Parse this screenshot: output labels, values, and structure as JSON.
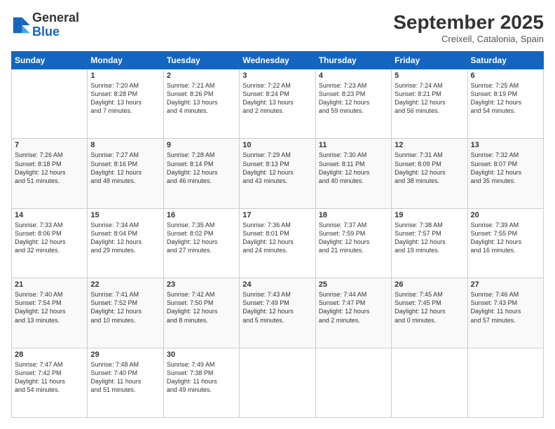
{
  "logo": {
    "line1": "General",
    "line2": "Blue"
  },
  "header": {
    "month": "September 2025",
    "location": "Creixell, Catalonia, Spain"
  },
  "weekdays": [
    "Sunday",
    "Monday",
    "Tuesday",
    "Wednesday",
    "Thursday",
    "Friday",
    "Saturday"
  ],
  "weeks": [
    [
      {
        "day": "",
        "info": ""
      },
      {
        "day": "1",
        "info": "Sunrise: 7:20 AM\nSunset: 8:28 PM\nDaylight: 13 hours\nand 7 minutes."
      },
      {
        "day": "2",
        "info": "Sunrise: 7:21 AM\nSunset: 8:26 PM\nDaylight: 13 hours\nand 4 minutes."
      },
      {
        "day": "3",
        "info": "Sunrise: 7:22 AM\nSunset: 8:24 PM\nDaylight: 13 hours\nand 2 minutes."
      },
      {
        "day": "4",
        "info": "Sunrise: 7:23 AM\nSunset: 8:23 PM\nDaylight: 12 hours\nand 59 minutes."
      },
      {
        "day": "5",
        "info": "Sunrise: 7:24 AM\nSunset: 8:21 PM\nDaylight: 12 hours\nand 56 minutes."
      },
      {
        "day": "6",
        "info": "Sunrise: 7:25 AM\nSunset: 8:19 PM\nDaylight: 12 hours\nand 54 minutes."
      }
    ],
    [
      {
        "day": "7",
        "info": "Sunrise: 7:26 AM\nSunset: 8:18 PM\nDaylight: 12 hours\nand 51 minutes."
      },
      {
        "day": "8",
        "info": "Sunrise: 7:27 AM\nSunset: 8:16 PM\nDaylight: 12 hours\nand 48 minutes."
      },
      {
        "day": "9",
        "info": "Sunrise: 7:28 AM\nSunset: 8:14 PM\nDaylight: 12 hours\nand 46 minutes."
      },
      {
        "day": "10",
        "info": "Sunrise: 7:29 AM\nSunset: 8:13 PM\nDaylight: 12 hours\nand 43 minutes."
      },
      {
        "day": "11",
        "info": "Sunrise: 7:30 AM\nSunset: 8:11 PM\nDaylight: 12 hours\nand 40 minutes."
      },
      {
        "day": "12",
        "info": "Sunrise: 7:31 AM\nSunset: 8:09 PM\nDaylight: 12 hours\nand 38 minutes."
      },
      {
        "day": "13",
        "info": "Sunrise: 7:32 AM\nSunset: 8:07 PM\nDaylight: 12 hours\nand 35 minutes."
      }
    ],
    [
      {
        "day": "14",
        "info": "Sunrise: 7:33 AM\nSunset: 8:06 PM\nDaylight: 12 hours\nand 32 minutes."
      },
      {
        "day": "15",
        "info": "Sunrise: 7:34 AM\nSunset: 8:04 PM\nDaylight: 12 hours\nand 29 minutes."
      },
      {
        "day": "16",
        "info": "Sunrise: 7:35 AM\nSunset: 8:02 PM\nDaylight: 12 hours\nand 27 minutes."
      },
      {
        "day": "17",
        "info": "Sunrise: 7:36 AM\nSunset: 8:01 PM\nDaylight: 12 hours\nand 24 minutes."
      },
      {
        "day": "18",
        "info": "Sunrise: 7:37 AM\nSunset: 7:59 PM\nDaylight: 12 hours\nand 21 minutes."
      },
      {
        "day": "19",
        "info": "Sunrise: 7:38 AM\nSunset: 7:57 PM\nDaylight: 12 hours\nand 19 minutes."
      },
      {
        "day": "20",
        "info": "Sunrise: 7:39 AM\nSunset: 7:55 PM\nDaylight: 12 hours\nand 16 minutes."
      }
    ],
    [
      {
        "day": "21",
        "info": "Sunrise: 7:40 AM\nSunset: 7:54 PM\nDaylight: 12 hours\nand 13 minutes."
      },
      {
        "day": "22",
        "info": "Sunrise: 7:41 AM\nSunset: 7:52 PM\nDaylight: 12 hours\nand 10 minutes."
      },
      {
        "day": "23",
        "info": "Sunrise: 7:42 AM\nSunset: 7:50 PM\nDaylight: 12 hours\nand 8 minutes."
      },
      {
        "day": "24",
        "info": "Sunrise: 7:43 AM\nSunset: 7:49 PM\nDaylight: 12 hours\nand 5 minutes."
      },
      {
        "day": "25",
        "info": "Sunrise: 7:44 AM\nSunset: 7:47 PM\nDaylight: 12 hours\nand 2 minutes."
      },
      {
        "day": "26",
        "info": "Sunrise: 7:45 AM\nSunset: 7:45 PM\nDaylight: 12 hours\nand 0 minutes."
      },
      {
        "day": "27",
        "info": "Sunrise: 7:46 AM\nSunset: 7:43 PM\nDaylight: 11 hours\nand 57 minutes."
      }
    ],
    [
      {
        "day": "28",
        "info": "Sunrise: 7:47 AM\nSunset: 7:42 PM\nDaylight: 11 hours\nand 54 minutes."
      },
      {
        "day": "29",
        "info": "Sunrise: 7:48 AM\nSunset: 7:40 PM\nDaylight: 11 hours\nand 51 minutes."
      },
      {
        "day": "30",
        "info": "Sunrise: 7:49 AM\nSunset: 7:38 PM\nDaylight: 11 hours\nand 49 minutes."
      },
      {
        "day": "",
        "info": ""
      },
      {
        "day": "",
        "info": ""
      },
      {
        "day": "",
        "info": ""
      },
      {
        "day": "",
        "info": ""
      }
    ]
  ]
}
